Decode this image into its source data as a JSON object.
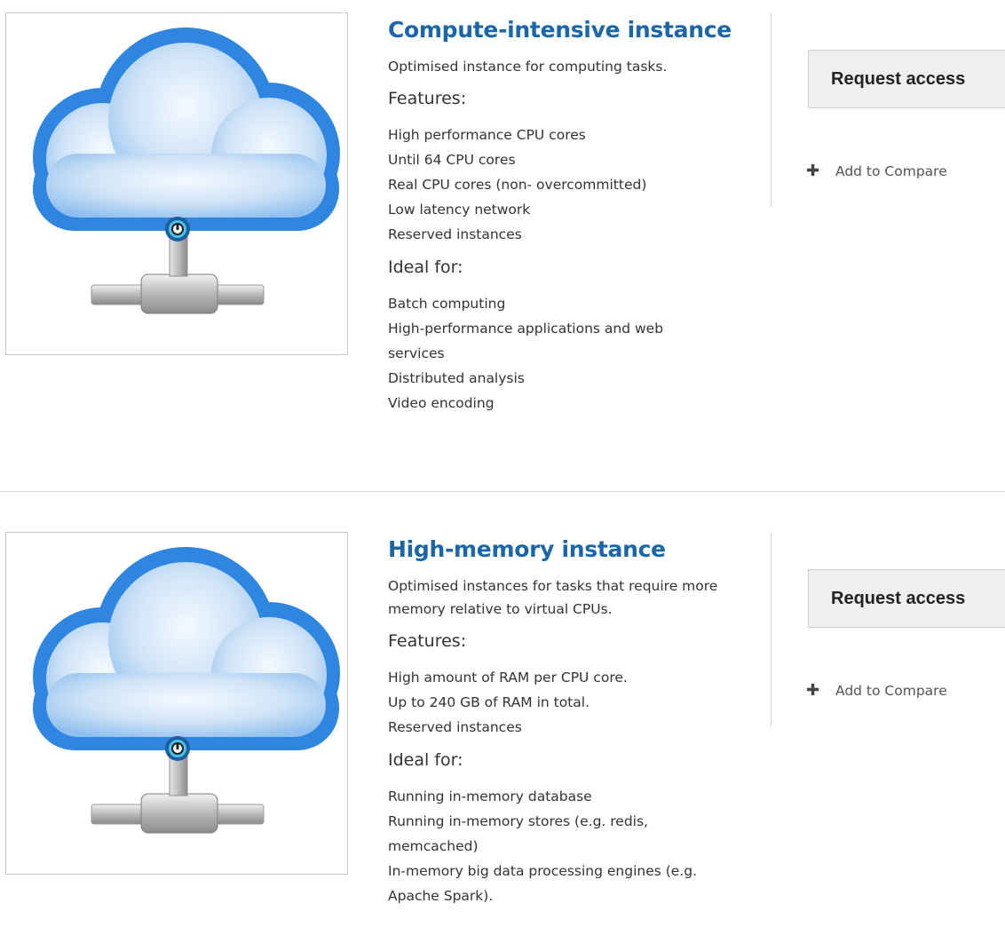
{
  "offerings": [
    {
      "image_icon": "cloud-network-icon",
      "title": "Compute-intensive instance",
      "description": "Optimised instance for computing tasks.",
      "features_heading": "Features:",
      "features": [
        "High performance CPU cores",
        "Until 64 CPU cores",
        "Real CPU cores (non- overcommitted)",
        "Low latency network",
        "Reserved instances"
      ],
      "ideal_heading": "Ideal for:",
      "ideal_for": [
        "Batch computing",
        "High-performance applications and web services",
        "Distributed analysis",
        "Video encoding"
      ],
      "request_label": "Request access",
      "compare_icon": "plus-icon",
      "compare_label": "Add to Compare"
    },
    {
      "image_icon": "cloud-network-icon",
      "title": "High-memory instance",
      "description": "Optimised instances for tasks that require more memory relative to virtual CPUs.",
      "features_heading": "Features:",
      "features": [
        "High amount of RAM per CPU core.",
        "Up to 240 GB of RAM in total.",
        "Reserved instances"
      ],
      "ideal_heading": "Ideal for:",
      "ideal_for": [
        "Running in-memory database",
        "Running in-memory stores (e.g. redis, memcached)",
        "In-memory big data processing engines (e.g. Apache Spark)."
      ],
      "request_label": "Request access",
      "compare_icon": "plus-icon",
      "compare_label": "Add to Compare"
    }
  ],
  "colors": {
    "title": "#1a66a8",
    "cloud_fill": "#2f86e0",
    "cloud_inner": "#cfe3f7"
  }
}
